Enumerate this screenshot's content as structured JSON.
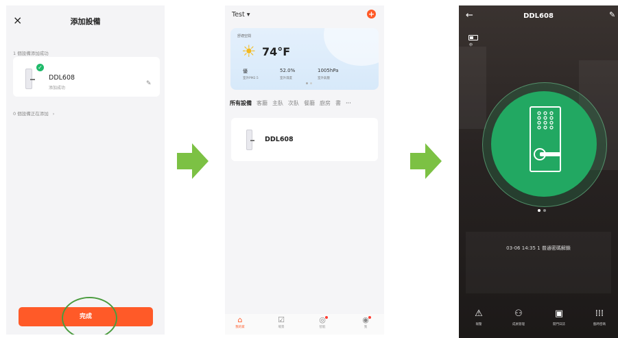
{
  "screen1": {
    "close_icon": "×",
    "title": "添加設備",
    "added_count": "1 個設備添加成功",
    "device_name": "DDL608",
    "device_status": "添加成功",
    "edit_icon": "✎",
    "adding_count": "0 個設備正在添加",
    "chevron": "›",
    "done_label": "完成",
    "accent": "#ff5a28",
    "check_color": "#1fba6a"
  },
  "screen2": {
    "home_name": "Test ▾",
    "add_icon": "+",
    "weather": {
      "location": "舒適空間",
      "icon": "sun-icon",
      "temperature": "74°F",
      "air_quality": "優",
      "air_quality_label": "室外PM2.5",
      "humidity": "52.0%",
      "humidity_label": "室外濕度",
      "pressure": "1005hPa",
      "pressure_label": "室外氣壓"
    },
    "rooms": [
      "所有設備",
      "客廳",
      "主臥",
      "次臥",
      "餐廳",
      "廚房",
      "書"
    ],
    "more": "···",
    "device_name": "DDL608",
    "tabbar": [
      {
        "label": "我的家",
        "icon": "home-icon"
      },
      {
        "label": "場景",
        "icon": "scene-icon"
      },
      {
        "label": "智能",
        "icon": "smart-icon"
      },
      {
        "label": "我",
        "icon": "profile-icon"
      }
    ]
  },
  "screen3": {
    "back_icon": "←",
    "title": "DDL608",
    "edit_icon": "✎",
    "battery_label": "中",
    "log_text": "03-06 14:35  1 普通密碼解鎖",
    "actions": [
      {
        "label": "報警",
        "icon": "alarm-icon"
      },
      {
        "label": "成員管理",
        "icon": "members-icon"
      },
      {
        "label": "開門日誌",
        "icon": "calendar-icon"
      },
      {
        "label": "臨時密碼",
        "icon": "keypad-icon"
      }
    ],
    "lock_color": "#22a862"
  }
}
